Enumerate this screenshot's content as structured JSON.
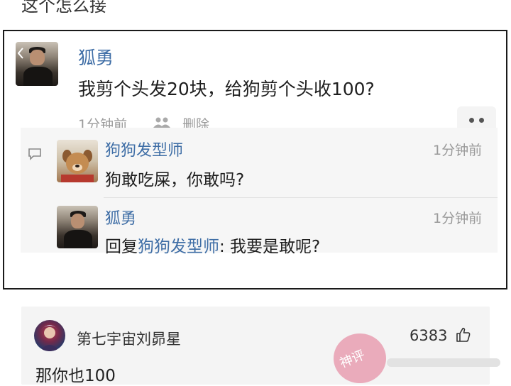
{
  "page": {
    "question": "这个怎么接"
  },
  "post": {
    "author": "狐勇",
    "text": "我剪个头发20块，给狗剪个头收100?",
    "time": "1分钟前",
    "delete_label": "删除"
  },
  "replies": [
    {
      "author": "狗狗发型师",
      "text": "狗敢吃屎，你敢吗?",
      "time": "1分钟前"
    },
    {
      "author": "狐勇",
      "reply_prefix": "回复",
      "reply_to": "狗狗发型师",
      "reply_text": ": 我要是敢呢?",
      "time": "1分钟前"
    }
  ],
  "comment": {
    "author": "第七宇宙刘昴星",
    "likes": "6383",
    "text": "那你也100"
  },
  "watermark": {
    "stamp_text": "神评"
  },
  "colors": {
    "link": "#3f6ea6",
    "muted": "#9a9a9a",
    "reply_bg": "#f6f6f6",
    "card_bg": "#f4f4f4"
  }
}
